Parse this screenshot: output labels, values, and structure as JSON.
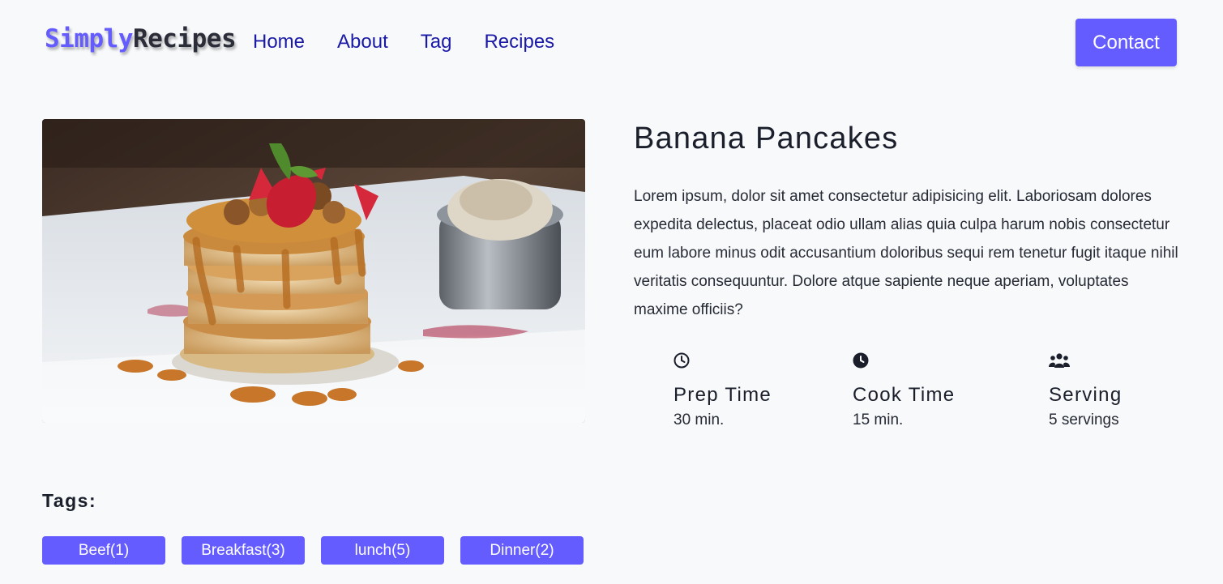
{
  "brand": {
    "part1": "Simply",
    "part2": "Recipes"
  },
  "nav": {
    "links": [
      {
        "label": "Home"
      },
      {
        "label": "About"
      },
      {
        "label": "Tag"
      },
      {
        "label": "Recipes"
      }
    ],
    "contact_label": "Contact"
  },
  "recipe": {
    "image_icon": "pancakes-photo",
    "title": "Banana Pancakes",
    "description": "Lorem ipsum, dolor sit amet consectetur adipisicing elit. Laboriosam dolores expedita delectus, placeat odio ullam alias quia culpa harum nobis consectetur eum labore minus odit accusantium doloribus sequi rem tenetur fugit itaque nihil veritatis consequuntur. Dolore atque sapiente neque aperiam, voluptates maxime officiis?",
    "info": [
      {
        "icon": "clock-outline-icon",
        "label": "Prep Time",
        "value": "30 min."
      },
      {
        "icon": "clock-solid-icon",
        "label": "Cook Time",
        "value": "15 min."
      },
      {
        "icon": "users-icon",
        "label": "Serving",
        "value": "5 servings"
      }
    ]
  },
  "tags": {
    "title": "Tags:",
    "items": [
      {
        "label": "Beef(1)"
      },
      {
        "label": "Breakfast(3)"
      },
      {
        "label": "lunch(5)"
      },
      {
        "label": "Dinner(2)"
      }
    ]
  },
  "colors": {
    "accent": "#645cff",
    "link": "#1a1aa6",
    "background": "#f8f9fb"
  }
}
